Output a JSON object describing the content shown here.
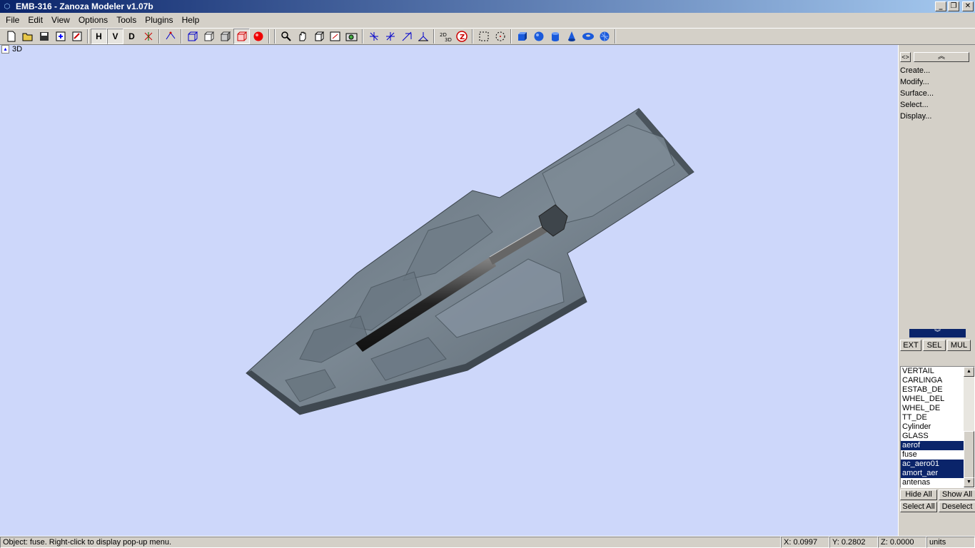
{
  "window": {
    "title": "EMB-316 - Zanoza Modeler v1.07b",
    "min": "_",
    "restore": "❐",
    "close": "✕"
  },
  "menu": [
    "File",
    "Edit",
    "View",
    "Options",
    "Tools",
    "Plugins",
    "Help"
  ],
  "toolbar": {
    "letters": {
      "h": "H",
      "v": "V",
      "d": "D"
    }
  },
  "viewport": {
    "label": "3D",
    "background": "#cdd7fa"
  },
  "panel": {
    "toggle": "<>",
    "expand": "︽",
    "collapse": "︾",
    "menu": [
      "Create...",
      "Modify...",
      "Surface...",
      "Select...",
      "Display..."
    ],
    "modes": [
      "EXT",
      "SEL",
      "MUL"
    ],
    "objects": [
      {
        "name": "VERTAIL",
        "selected": false
      },
      {
        "name": "CARLINGA",
        "selected": false
      },
      {
        "name": "ESTAB_DE",
        "selected": false
      },
      {
        "name": "WHEL_DEL",
        "selected": false
      },
      {
        "name": "WHEL_DE",
        "selected": false
      },
      {
        "name": "TT_DE",
        "selected": false
      },
      {
        "name": "Cylinder",
        "selected": false
      },
      {
        "name": "GLASS",
        "selected": false
      },
      {
        "name": "aerof",
        "selected": true
      },
      {
        "name": "fuse",
        "selected": false
      },
      {
        "name": "ac_aero01",
        "selected": true
      },
      {
        "name": "amort_aer",
        "selected": true
      },
      {
        "name": "antenas",
        "selected": false
      }
    ],
    "buttons": {
      "hide_all": "Hide All",
      "show_all": "Show All",
      "select_all": "Select All",
      "deselect": "Deselect"
    }
  },
  "status": {
    "message": "Object: fuse. Right-click to display pop-up menu.",
    "x": "X: 0.0997",
    "y": "Y: 0.2802",
    "z": "Z: 0.0000",
    "units": "units"
  }
}
